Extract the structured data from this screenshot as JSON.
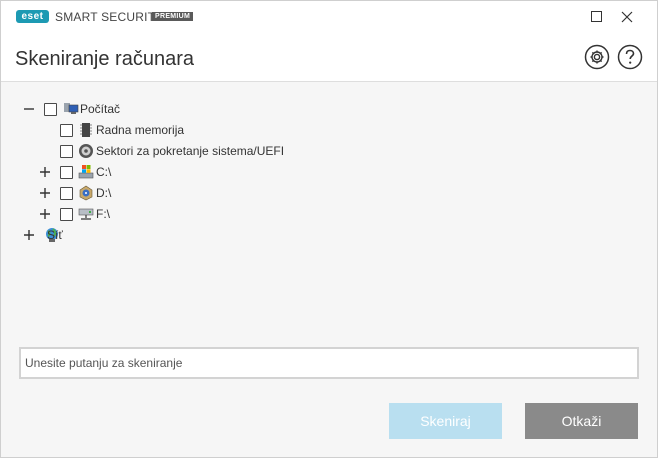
{
  "titlebar": {
    "logo_text": "eset",
    "product_name": "SMART SECURITY",
    "edition_badge": "PREMIUM",
    "minimize_icon": "maximize-icon",
    "close_icon": "close-icon"
  },
  "header": {
    "title": "Skeniranje računara",
    "settings_icon": "gear-icon",
    "help_icon": "help-icon"
  },
  "tree": {
    "root": {
      "label": "Počítač",
      "expander": "−",
      "icon": "computer-icon"
    },
    "items": [
      {
        "label": "Radna memorija",
        "icon": "memory-chip-icon"
      },
      {
        "label": "Sektori za pokretanje sistema/UEFI",
        "icon": "disc-icon"
      },
      {
        "label": "C:\\",
        "expander": "+",
        "icon": "system-drive-icon"
      },
      {
        "label": "D:\\",
        "expander": "+",
        "icon": "cd-drive-icon"
      },
      {
        "label": "F:\\",
        "expander": "+",
        "icon": "network-drive-icon"
      }
    ],
    "network": {
      "label": "Síť",
      "expander": "+",
      "icon": "network-globe-icon"
    }
  },
  "path_input": {
    "placeholder": "Unesite putanju za skeniranje",
    "value": ""
  },
  "buttons": {
    "scan_label": "Skeniraj",
    "cancel_label": "Otkaži"
  },
  "colors": {
    "brand": "#1d9ab3",
    "scan_button_disabled": "#b9dff0",
    "cancel_button": "#8a8a8a",
    "window_background": "#f6f6f6"
  }
}
